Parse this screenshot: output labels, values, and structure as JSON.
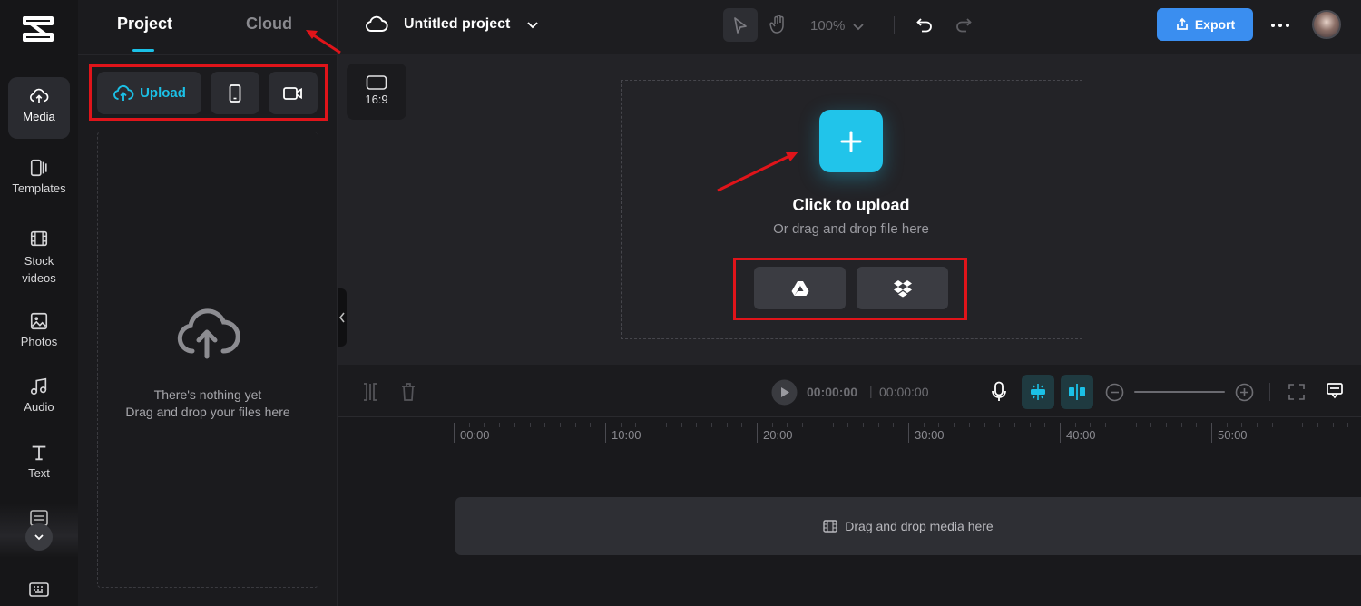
{
  "rail": {
    "items": [
      {
        "label": "Media",
        "icon": "cloud-upload-icon"
      },
      {
        "label": "Templates",
        "icon": "templates-icon"
      },
      {
        "label": "Stock",
        "label2": "videos",
        "icon": "film-icon"
      },
      {
        "label": "Photos",
        "icon": "image-icon"
      },
      {
        "label": "Audio",
        "icon": "music-note-icon"
      },
      {
        "label": "Text",
        "icon": "text-t-icon"
      }
    ]
  },
  "panel": {
    "tabs": [
      {
        "label": "Project"
      },
      {
        "label": "Cloud"
      }
    ],
    "upload_label": "Upload",
    "empty_line1": "There's nothing yet",
    "empty_line2": "Drag and drop your files here"
  },
  "header": {
    "project_title": "Untitled project",
    "zoom": "100%",
    "export_label": "Export"
  },
  "canvas": {
    "ratio": "16:9",
    "click_to_upload": "Click to upload",
    "or_drag": "Or drag and drop file here"
  },
  "timeline": {
    "current_time": "00:00:00",
    "separator": "|",
    "total_time": "00:00:00",
    "ticks": [
      "00:00",
      "10:00",
      "20:00",
      "30:00",
      "40:00",
      "50:00"
    ],
    "track_hint": "Drag and drop media here"
  },
  "colors": {
    "accent": "#1bc0e6",
    "export": "#3a8ef0",
    "annotation_red": "#e0141a"
  }
}
